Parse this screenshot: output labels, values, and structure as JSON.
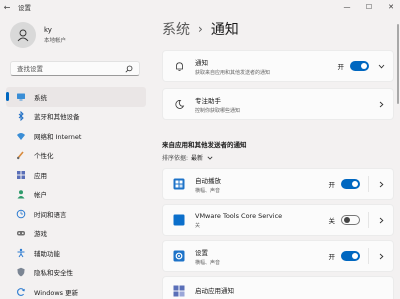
{
  "window": {
    "title": "设置",
    "back_glyph": "←",
    "minimize_glyph": "—",
    "maximize_glyph": "☐",
    "close_glyph": "✕"
  },
  "user": {
    "name": "ky",
    "account_type": "本地帐户"
  },
  "search": {
    "placeholder": "查找设置"
  },
  "sidebar": {
    "items": [
      {
        "label": "系统",
        "icon": "monitor-icon",
        "active": true
      },
      {
        "label": "蓝牙和其他设备",
        "icon": "bluetooth-icon"
      },
      {
        "label": "网络和 Internet",
        "icon": "wifi-icon"
      },
      {
        "label": "个性化",
        "icon": "paintbrush-icon"
      },
      {
        "label": "应用",
        "icon": "apps-icon"
      },
      {
        "label": "帐户",
        "icon": "person-icon"
      },
      {
        "label": "时间和语言",
        "icon": "globe-clock-icon"
      },
      {
        "label": "游戏",
        "icon": "gamepad-icon"
      },
      {
        "label": "辅助功能",
        "icon": "accessibility-icon"
      },
      {
        "label": "隐私和安全性",
        "icon": "shield-icon"
      },
      {
        "label": "Windows 更新",
        "icon": "update-icon"
      }
    ]
  },
  "breadcrumb": {
    "parent": "系统",
    "separator": "›",
    "current": "通知"
  },
  "notifications": {
    "title": "通知",
    "description": "获取来自应用和其他发送者的通知",
    "state_label": "开",
    "enabled": true
  },
  "focus_assist": {
    "title": "专注助手",
    "description": "控制你获取哪些通知"
  },
  "section": {
    "heading": "来自应用和其他发送者的通知",
    "sort_label": "排序依据:",
    "sort_value": "最新"
  },
  "apps": [
    {
      "title": "自动播放",
      "description": "横幅、声音",
      "state_label": "开",
      "enabled": true,
      "icon": "autoplay-icon"
    },
    {
      "title": "VMware Tools Core Service",
      "description": "关",
      "state_label": "关",
      "enabled": false,
      "icon": "vmware-icon"
    },
    {
      "title": "设置",
      "description": "横幅、声音",
      "state_label": "开",
      "enabled": true,
      "icon": "settings-gear-icon"
    },
    {
      "title": "启动应用通知",
      "description": "",
      "state_label": "",
      "enabled": null,
      "icon": "startup-apps-icon"
    }
  ],
  "colors": {
    "accent": "#0067c0",
    "background": "#f3f1f1",
    "card": "#fbfbfb"
  }
}
